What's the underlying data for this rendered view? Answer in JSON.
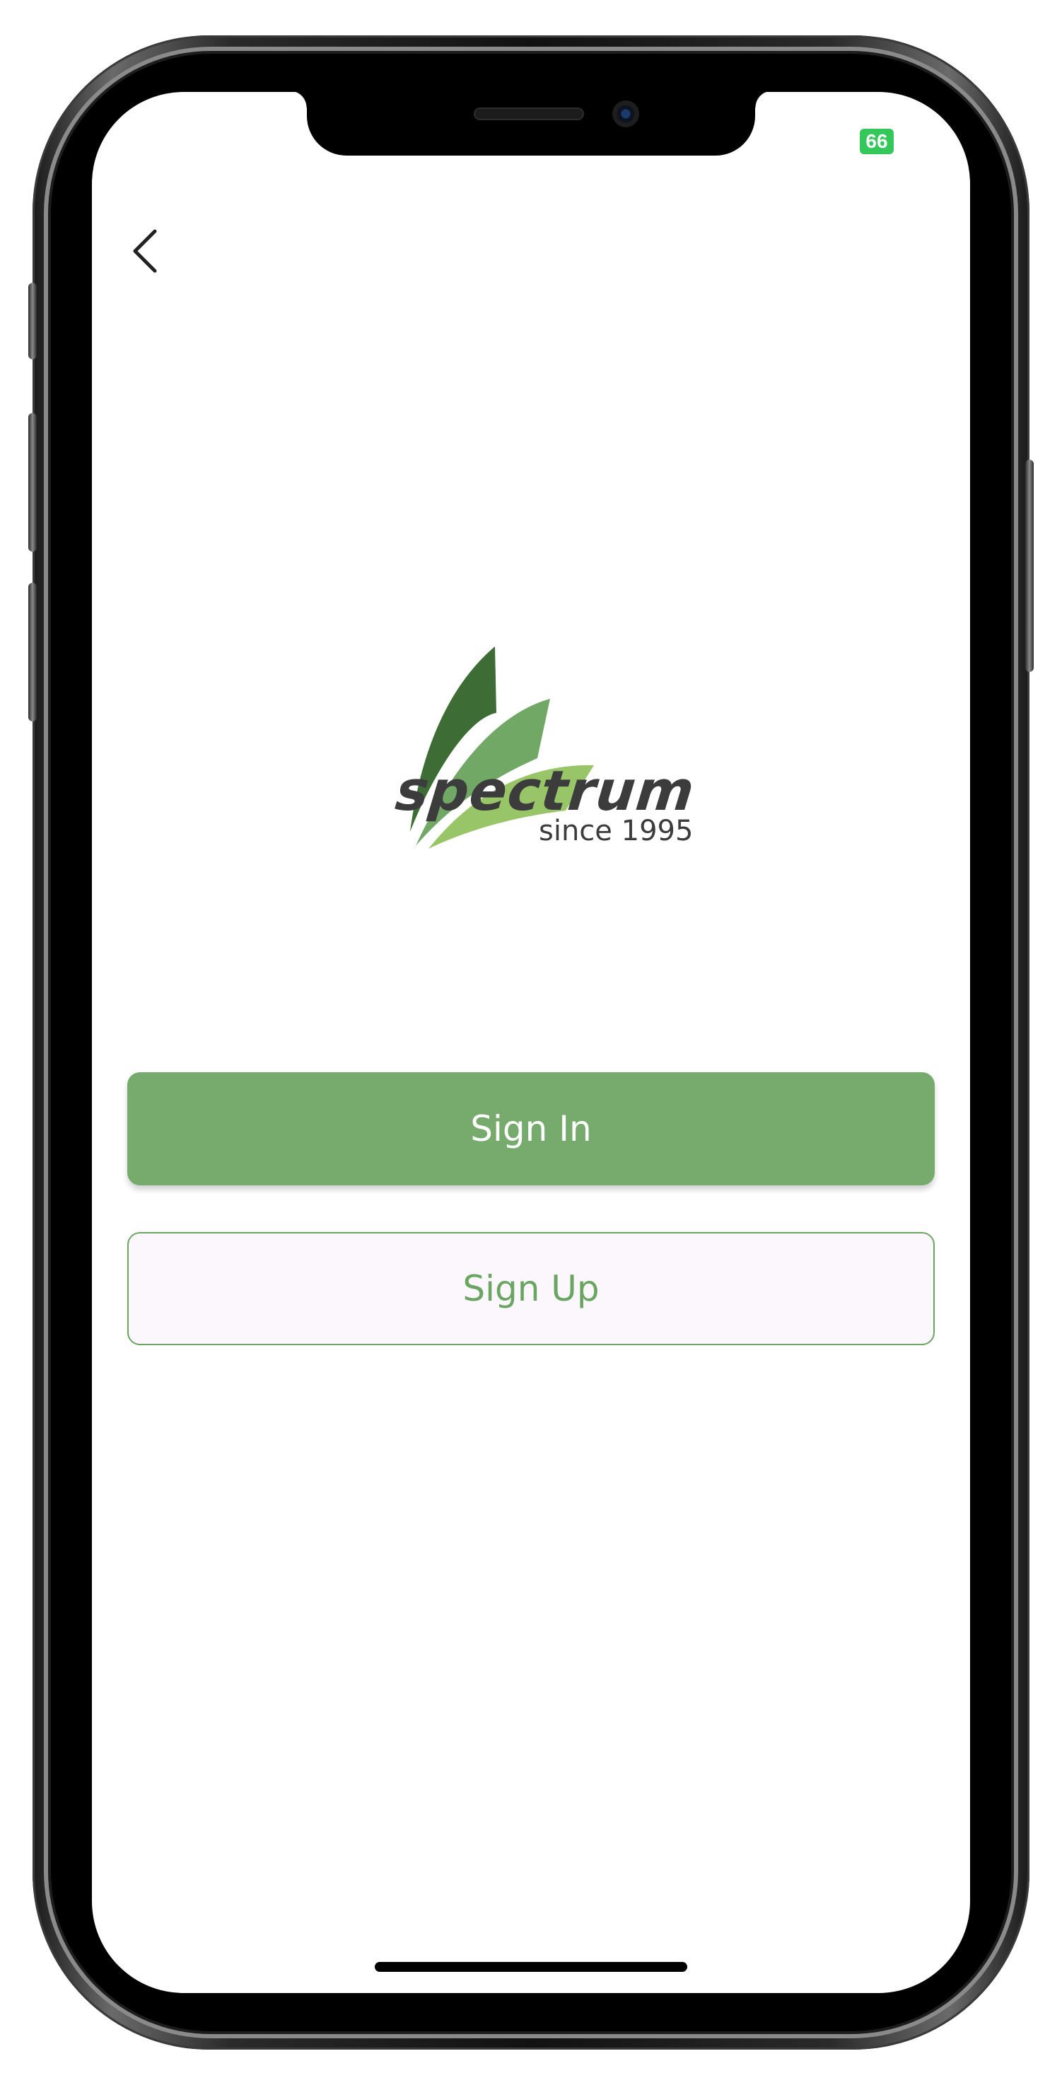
{
  "status_bar": {
    "battery_level": "66",
    "battery_color": "#34c759"
  },
  "nav": {
    "back_icon": "chevron-left-icon"
  },
  "logo": {
    "wordmark": "spectrum",
    "tagline": "since 1995",
    "colors": [
      "#3d6d34",
      "#72a865",
      "#98c567"
    ]
  },
  "actions": {
    "sign_in_label": "Sign In",
    "sign_up_label": "Sign Up",
    "primary_color": "#76ab6d",
    "secondary_bg": "#fcf7fc"
  }
}
